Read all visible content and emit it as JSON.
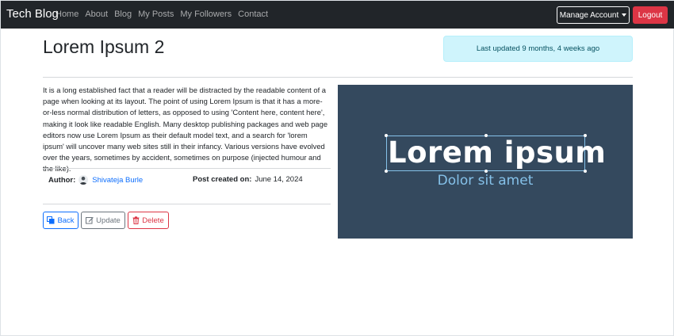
{
  "navbar": {
    "brand": "Tech Blog",
    "links": [
      "Home",
      "About",
      "Blog",
      "My Posts",
      "My Followers",
      "Contact"
    ],
    "manage_account_label": "Manage Account",
    "logout_label": "Logout",
    "colors": {
      "background": "#212529",
      "logout": "#dc3545"
    }
  },
  "post": {
    "title": "Lorem Ipsum 2",
    "last_updated": "Last updated 9 months, 4 weeks ago",
    "body": "It is a long established fact that a reader will be distracted by the readable content of a page when looking at its layout. The point of using Lorem Ipsum is that it has a more-or-less normal distribution of letters, as opposed to using 'Content here, content here', making it look like readable English. Many desktop publishing packages and web page editors now use Lorem Ipsum as their default model text, and a search for 'lorem ipsum' will uncover many web sites still in their infancy. Various versions have evolved over the years, sometimes by accident, sometimes on purpose (injected humour and the like).",
    "author_label": "Author:",
    "author_name": "Shivateja Burle",
    "created_label": "Post created on:",
    "created_date": "June 14, 2024",
    "image": {
      "title": "Lorem ipsum",
      "subtitle": "Dolor sit amet",
      "colors": {
        "background": "#34495e",
        "subtitle": "#85c1e9"
      }
    }
  },
  "actions": {
    "back_label": "Back",
    "update_label": "Update",
    "delete_label": "Delete"
  }
}
